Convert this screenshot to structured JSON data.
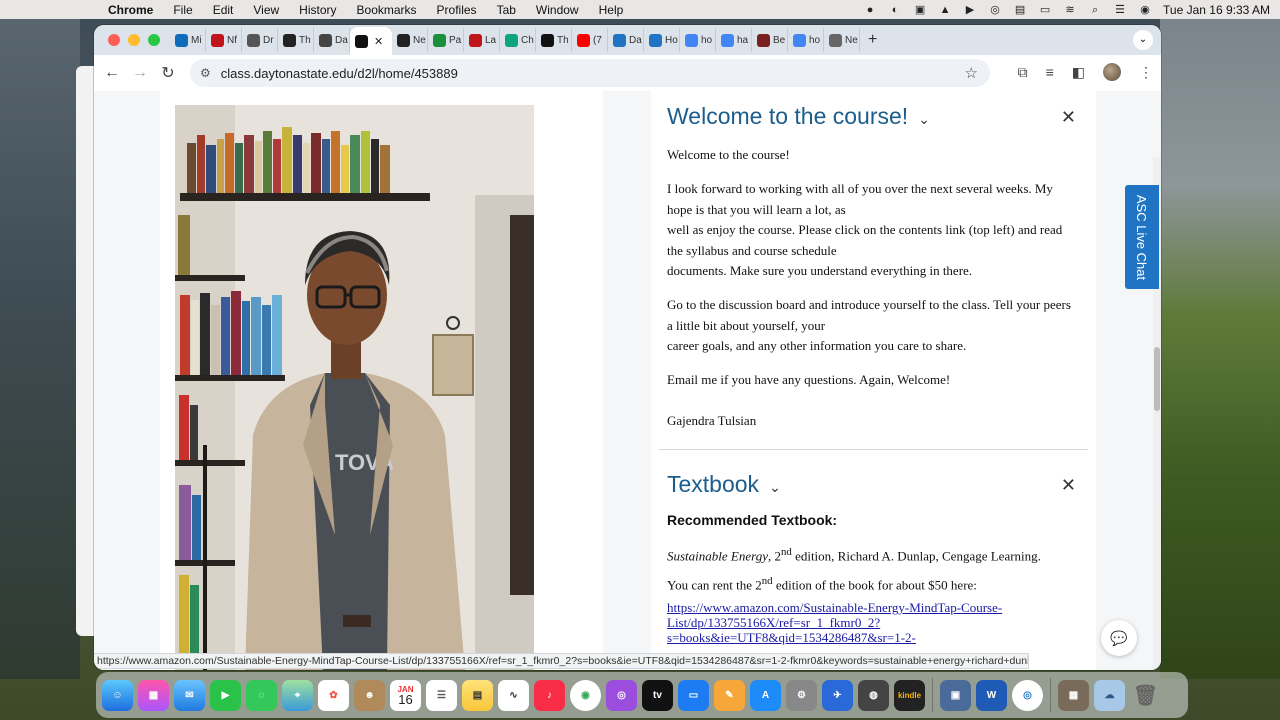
{
  "menubar": {
    "app_name": "Chrome",
    "items": [
      "File",
      "Edit",
      "View",
      "History",
      "Bookmarks",
      "Profiles",
      "Tab",
      "Window",
      "Help"
    ],
    "clock": "Tue Jan 16  9:33 AM"
  },
  "tabs": [
    {
      "label": "Mi",
      "icon": "outlook-icon",
      "color": "#0f6cbd"
    },
    {
      "label": "Nf",
      "icon": "news-icon",
      "color": "#c0141b"
    },
    {
      "label": "Dr",
      "icon": "web-icon",
      "color": "#555555"
    },
    {
      "label": "Th",
      "icon": "nyt-icon",
      "color": "#222222"
    },
    {
      "label": "Da",
      "icon": "nature-icon",
      "color": "#444444"
    },
    {
      "label": "",
      "icon": "d2l-icon",
      "color": "#111111",
      "active": true
    },
    {
      "label": "Ne",
      "icon": "nyt-icon",
      "color": "#222222"
    },
    {
      "label": "Pa",
      "icon": "chat-icon",
      "color": "#1a8f3c"
    },
    {
      "label": "La",
      "icon": "diamond-icon",
      "color": "#c0141b"
    },
    {
      "label": "Ch",
      "icon": "openai-icon",
      "color": "#10a37f"
    },
    {
      "label": "Th",
      "icon": "wsj-icon",
      "color": "#111111"
    },
    {
      "label": "(7",
      "icon": "youtube-icon",
      "color": "#ff0000"
    },
    {
      "label": "Da",
      "icon": "globe-icon",
      "color": "#1f75c4"
    },
    {
      "label": "Ho",
      "icon": "globe-icon",
      "color": "#1f75c4"
    },
    {
      "label": "ho",
      "icon": "google-icon",
      "color": "#4285f4"
    },
    {
      "label": "ha",
      "icon": "google-icon",
      "color": "#4285f4"
    },
    {
      "label": "Be",
      "icon": "bookmark-icon",
      "color": "#7a1f1f"
    },
    {
      "label": "ho",
      "icon": "google-icon",
      "color": "#4285f4"
    },
    {
      "label": "Ne",
      "icon": "globe-icon",
      "color": "#666666"
    }
  ],
  "omnibox": {
    "url": "class.daytonastate.edu/d2l/home/453889"
  },
  "welcome": {
    "title": "Welcome to the course!",
    "greeting": "Welcome to the course!",
    "p1_l1": "I look forward to working with all of you over  the next several weeks. My",
    "p1_l2": "hope is that you will learn a lot, as",
    "p1_l3": "well as enjoy the course. Please click on the contents link (top left) and read",
    "p1_l4": "the syllabus and course schedule",
    "p1_l5": "documents. Make sure you understand everything in there.",
    "p2_l1": "Go to the discussion board and introduce yourself to the class. Tell your peers",
    "p2_l2": "a little bit about yourself, your",
    "p2_l3": "career goals, and any other information you care to share.",
    "p3": "Email me if you have any questions.  Again, Welcome!",
    "signature": "Gajendra Tulsian"
  },
  "textbook": {
    "title": "Textbook",
    "heading": "Recommended Textbook:",
    "book_title": "Sustainable Energy",
    "edition_num": "2",
    "edition_sup": "nd",
    "book_rest": " edition, Richard A. Dunlap, Cengage Learning.",
    "rent_pre": "You can rent the 2",
    "rent_sup": "nd",
    "rent_post": " edition of the book for about $50 here:",
    "link_l1": "https://www.amazon.com/Sustainable-Energy-MindTap-Course-",
    "link_l2": "List/dp/133755166X/ref=sr_1_fkmr0_2?",
    "link_l3": "s=books&ie=UTF8&qid=1534286487&sr=1-2-"
  },
  "status_url": "https://www.amazon.com/Sustainable-Energy-MindTap-Course-List/dp/133755166X/ref=sr_1_fkmr0_2?s=books&ie=UTF8&qid=1534286487&sr=1-2-fkmr0&keywords=sustainable+energy+richard+dunlop",
  "chat_tab": "ASC Live Chat",
  "dock": {
    "calendar_month": "JAN",
    "calendar_day": "16",
    "kindle_label": "kindle",
    "word_label": "W"
  }
}
